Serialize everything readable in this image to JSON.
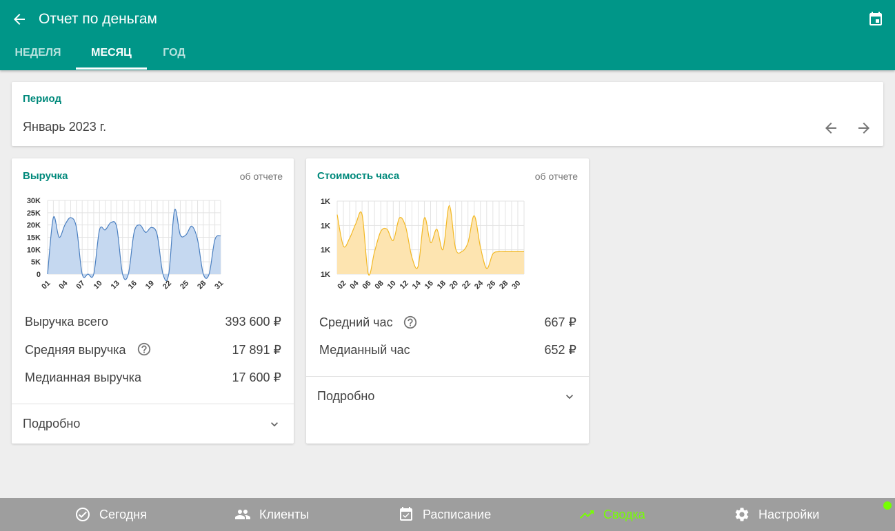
{
  "header": {
    "title": "Отчет по деньгам",
    "tabs": [
      "НЕДЕЛЯ",
      "МЕСЯЦ",
      "ГОД"
    ],
    "active_tab": "МЕСЯЦ"
  },
  "period": {
    "label": "Период",
    "value": "Январь 2023 г."
  },
  "revenue_card": {
    "title": "Выручка",
    "about": "об отчете",
    "stats": [
      {
        "label": "Выручка всего",
        "value": "393 600 ₽"
      },
      {
        "label": "Средняя выручка",
        "value": "17 891 ₽"
      },
      {
        "label": "Медианная выручка",
        "value": "17 600 ₽"
      }
    ],
    "more": "Подробно"
  },
  "hour_card": {
    "title": "Стоимость часа",
    "about": "об отчете",
    "stats": [
      {
        "label": "Средний час",
        "value": "667 ₽"
      },
      {
        "label": "Медианный час",
        "value": "652 ₽"
      }
    ],
    "more": "Подробно"
  },
  "bottom_nav": [
    {
      "label": "Сегодня",
      "icon": "check-circle-icon"
    },
    {
      "label": "Клиенты",
      "icon": "people-icon"
    },
    {
      "label": "Расписание",
      "icon": "calendar-check-icon"
    },
    {
      "label": "Сводка",
      "icon": "trending-up-icon"
    },
    {
      "label": "Настройки",
      "icon": "gear-icon"
    }
  ],
  "colors": {
    "primary": "#009688",
    "accent_text": "#00897b",
    "active_nav": "#76ff03",
    "revenue_fill": "#c5d8f0",
    "revenue_line": "#4a7fc0",
    "hour_fill": "#fde4b0",
    "hour_line": "#f2b824"
  },
  "chart_data": [
    {
      "type": "area",
      "yticks": [
        "0",
        "5K",
        "10K",
        "15K",
        "20K",
        "25K",
        "30K"
      ],
      "ylim": [
        0,
        30000
      ],
      "xticks": [
        "01",
        "04",
        "07",
        "10",
        "13",
        "16",
        "19",
        "22",
        "25",
        "28",
        "31"
      ],
      "x": [
        1,
        2,
        3,
        4,
        5,
        6,
        7,
        8,
        9,
        10,
        11,
        12,
        13,
        14,
        15,
        16,
        17,
        18,
        19,
        20,
        21,
        22,
        23,
        24,
        25,
        26,
        27,
        28,
        29,
        30,
        31
      ],
      "values": [
        0,
        23000,
        15000,
        20000,
        23000,
        19000,
        0,
        0,
        0,
        18000,
        18000,
        21000,
        19000,
        0,
        0,
        17000,
        20000,
        17000,
        19000,
        16000,
        0,
        0,
        26000,
        16000,
        16000,
        19500,
        14000,
        0,
        0,
        14000,
        15600
      ]
    },
    {
      "type": "area",
      "yticks": [
        "1K",
        "1K",
        "1K",
        "1K"
      ],
      "xticks": [
        "02",
        "04",
        "06",
        "08",
        "10",
        "12",
        "14",
        "16",
        "18",
        "20",
        "22",
        "24",
        "26",
        "28",
        "30"
      ],
      "x": [
        1,
        2,
        3,
        4,
        5,
        6,
        7,
        8,
        9,
        10,
        11,
        12,
        13,
        14,
        15,
        16,
        17,
        18,
        19,
        20,
        21,
        22,
        23,
        24,
        25,
        26,
        27,
        28,
        29,
        30,
        31
      ],
      "values": [
        930,
        650,
        720,
        850,
        930,
        400,
        600,
        780,
        800,
        700,
        900,
        820,
        550,
        470,
        900,
        680,
        800,
        620,
        1010,
        630,
        600,
        680,
        920,
        640,
        450,
        580,
        600,
        600,
        600,
        600,
        600
      ],
      "ylim": [
        400,
        1050
      ]
    }
  ]
}
